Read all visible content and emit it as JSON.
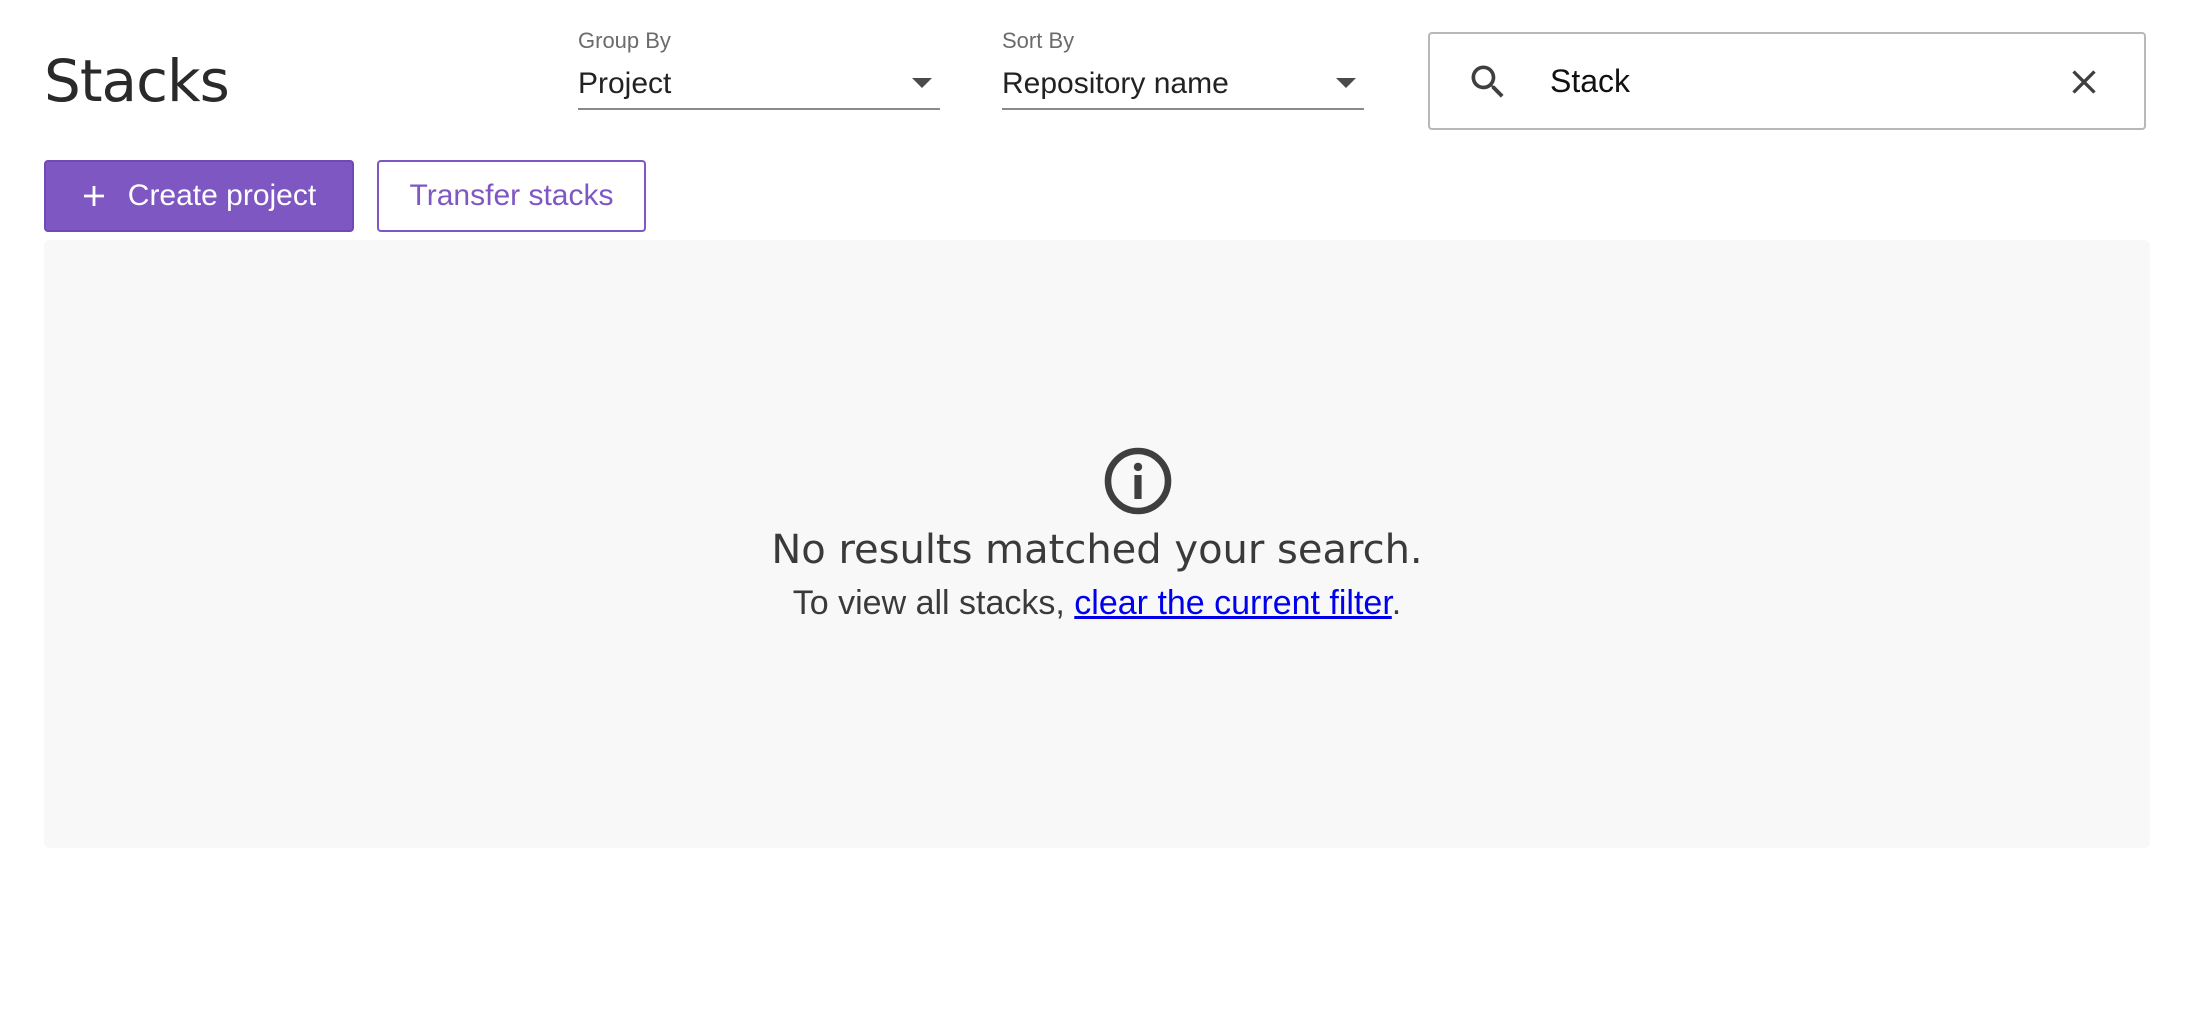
{
  "header": {
    "title": "Stacks"
  },
  "filters": {
    "group_by": {
      "label": "Group By",
      "value": "Project"
    },
    "sort_by": {
      "label": "Sort By",
      "value": "Repository name"
    }
  },
  "search": {
    "value": "Stack",
    "icon": "search-icon",
    "clear_icon": "close-icon"
  },
  "actions": {
    "create_project_label": "Create project",
    "create_project_icon": "plus-icon",
    "transfer_stacks_label": "Transfer stacks"
  },
  "empty_state": {
    "icon": "info-icon",
    "heading": "No results matched your search.",
    "message_prefix": "To view all stacks, ",
    "link_text": "clear the current filter",
    "message_suffix": "."
  },
  "colors": {
    "accent": "#7e57c2",
    "link": "#0000ee",
    "panel_background": "#f8f8f8"
  }
}
